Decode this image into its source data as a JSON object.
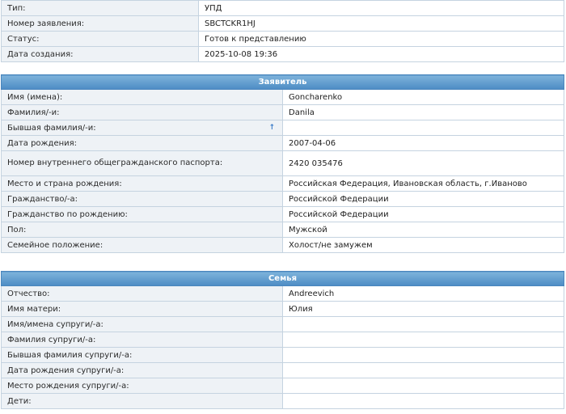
{
  "summary": [
    {
      "label": "Тип:",
      "value": "УПД"
    },
    {
      "label": "Номер заявления:",
      "value": "SBCTCKR1HJ"
    },
    {
      "label": "Статус:",
      "value": "Готов к представлению"
    },
    {
      "label": "Дата создания:",
      "value": "2025-10-08 19:36"
    }
  ],
  "applicant": {
    "title": "Заявитель",
    "rows": [
      {
        "label": "Имя (имена):",
        "value": "Goncharenko"
      },
      {
        "label": "Фамилия/-и:",
        "value": "Danila"
      },
      {
        "label": "Бывшая фамилия/-и:",
        "value": "",
        "icon": "info-icon"
      },
      {
        "label": "Дата рождения:",
        "value": "2007-04-06"
      },
      {
        "label": "Номер внутреннего общегражданского паспорта:",
        "value": "2420 035476"
      },
      {
        "label": "Место и страна рождения:",
        "value": "Российская Федерация, Ивановская область, г.Иваново"
      },
      {
        "label": "Гражданство/-а:",
        "value": "Российской Федерации"
      },
      {
        "label": "Гражданство по рождению:",
        "value": "Российской Федерации"
      },
      {
        "label": "Пол:",
        "value": "Мужской"
      },
      {
        "label": "Семейное положение:",
        "value": "Холост/не замужем"
      }
    ]
  },
  "family": {
    "title": "Семья",
    "rows": [
      {
        "label": "Отчество:",
        "value": "Andreevich"
      },
      {
        "label": "Имя матери:",
        "value": "Юлия"
      },
      {
        "label": "Имя/имена супруги/-а:",
        "value": ""
      },
      {
        "label": "Фамилия супруги/-а:",
        "value": ""
      },
      {
        "label": "Бывшая фамилия супруги/-а:",
        "value": ""
      },
      {
        "label": "Дата рождения супруги/-а:",
        "value": ""
      },
      {
        "label": "Место рождения супруги/-а:",
        "value": ""
      },
      {
        "label": "Дети:",
        "value": ""
      }
    ]
  }
}
